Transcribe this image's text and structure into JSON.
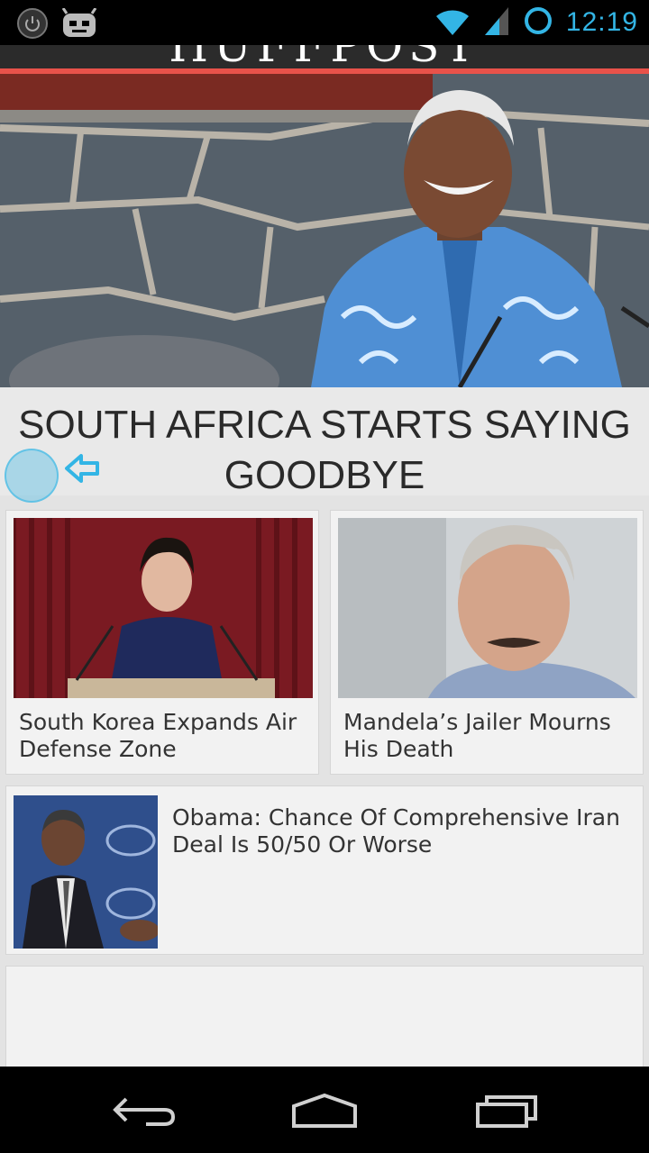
{
  "status_bar": {
    "time": "12:19",
    "icons": [
      "power-notification-icon",
      "android-debug-icon",
      "wifi-icon",
      "cell-signal-icon",
      "sync-ring-icon"
    ]
  },
  "app": {
    "masthead": "HUFFPOST",
    "accent_color": "#e8524a"
  },
  "featured": {
    "headline": "SOUTH AFRICA STARTS SAYING GOODBYE",
    "image": "nelson-mandela-photo"
  },
  "stories": [
    {
      "title": "South Korea Expands Air Defense Zone",
      "image": "speaker-at-podium-photo"
    },
    {
      "title": "Mandela’s Jailer Mourns His Death",
      "image": "gray-haired-man-photo"
    },
    {
      "title": "Obama: Chance Of Comprehensive Iran Deal Is 50/50 Or Worse",
      "image": "obama-speaking-photo"
    }
  ],
  "nav_bar": {
    "buttons": [
      "back-icon",
      "home-icon",
      "recents-icon"
    ]
  },
  "colors": {
    "system_accent": "#33b5e5",
    "content_bg": "#e3e3e3",
    "card_bg": "#f2f2f2"
  }
}
